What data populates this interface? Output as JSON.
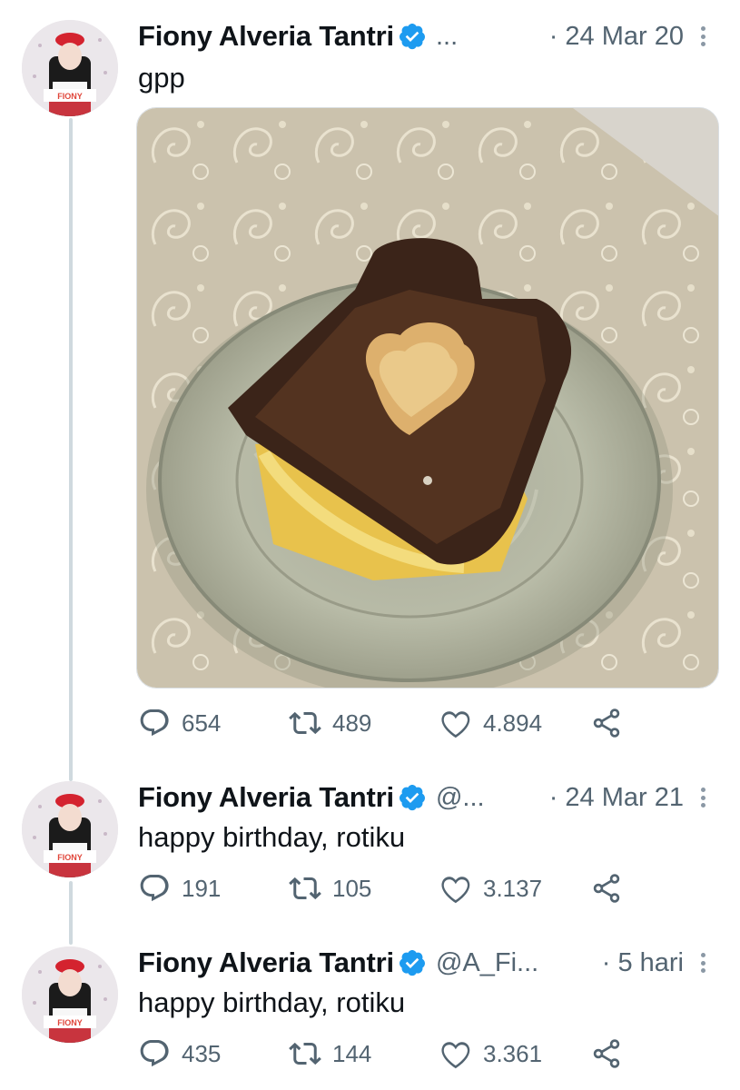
{
  "tweets": [
    {
      "author": "Fiony Alveria Tantri",
      "handle": "...",
      "date": "· 24 Mar 20",
      "text": "gpp",
      "image": "toast-with-heart-egg-photo",
      "replies": "654",
      "retweets": "489",
      "likes": "4.894"
    },
    {
      "author": "Fiony Alveria Tantri",
      "handle": "@...",
      "date": "· 24 Mar 21",
      "text": "happy birthday, rotiku",
      "replies": "191",
      "retweets": "105",
      "likes": "3.137"
    },
    {
      "author": "Fiony Alveria Tantri",
      "handle": "@A_Fi...",
      "date": "· 5 hari",
      "text": "happy birthday, rotiku",
      "replies": "435",
      "retweets": "144",
      "likes": "3.361"
    }
  ],
  "avatar": {
    "badge_text": "FIONY"
  },
  "icons": {
    "verified": "verified-badge-icon",
    "reply": "reply-icon",
    "retweet": "retweet-icon",
    "like": "heart-icon",
    "share": "share-icon",
    "more": "more-options-icon"
  },
  "colors": {
    "verified": "#1d9bf0",
    "secondary_text": "#536471",
    "thread_line": "#cfd9de"
  }
}
